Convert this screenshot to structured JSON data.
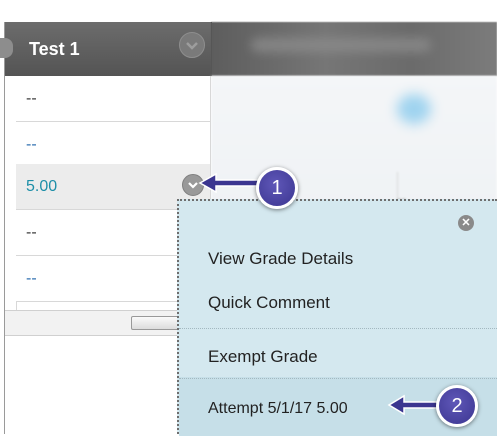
{
  "column": {
    "title": "Test 1"
  },
  "cells": [
    "--",
    "--",
    "5.00",
    "--",
    "--"
  ],
  "blurred": {
    "cell_value": "--"
  },
  "menu": {
    "items": [
      "View Grade Details",
      "Quick Comment",
      "Exempt Grade",
      "Attempt 5/1/17 5.00"
    ],
    "close_glyph": "✕"
  },
  "callouts": {
    "first": "1",
    "second": "2"
  },
  "colors": {
    "callout": "#3b3590",
    "header": "#5e5e5e",
    "menu_bg": "#d4e8ef",
    "link": "#2f6fb0",
    "selected_value": "#1e8fa8"
  }
}
